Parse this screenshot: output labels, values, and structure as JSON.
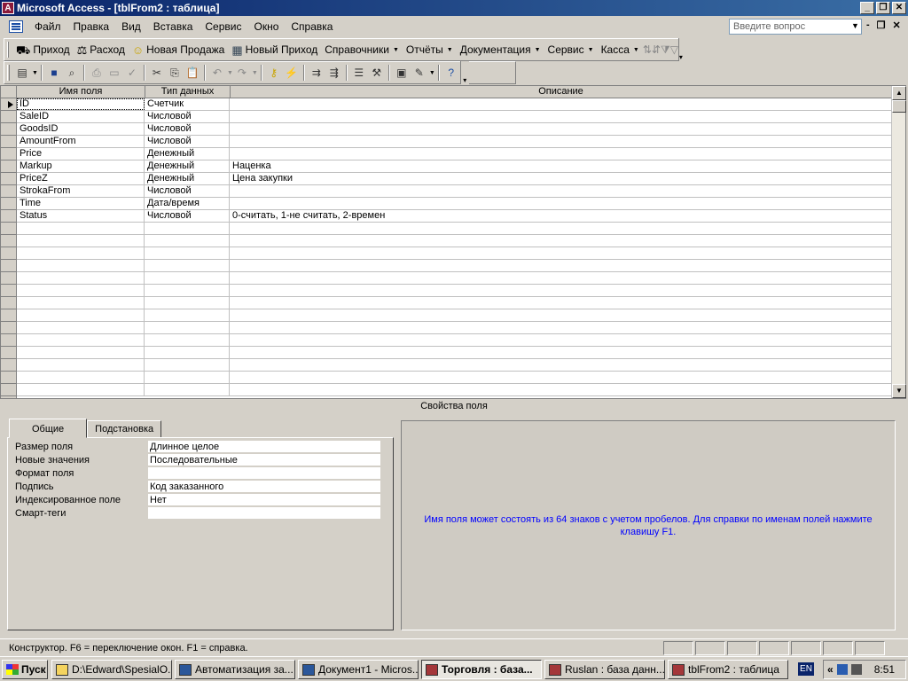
{
  "window": {
    "title": "Microsoft Access - [tblFrom2 : таблица]",
    "app_icon": "access-icon",
    "controls": [
      "_",
      "❐",
      "✕"
    ]
  },
  "menu": {
    "items": [
      "Файл",
      "Правка",
      "Вид",
      "Вставка",
      "Сервис",
      "Окно",
      "Справка"
    ],
    "ask_placeholder": "Введите вопрос",
    "doc_controls": [
      "-",
      "❐",
      "✕"
    ]
  },
  "custom_toolbar": {
    "buttons": [
      {
        "label": "Приход",
        "icon": "truck-icon",
        "has_menu": false
      },
      {
        "label": "Расход",
        "icon": "scales-icon",
        "has_menu": false
      },
      {
        "label": "Новая Продажа",
        "icon": "smiley-icon",
        "has_menu": false
      },
      {
        "label": "Новый Приход",
        "icon": "document-icon",
        "has_menu": false
      },
      {
        "label": "Справочники",
        "icon": "",
        "has_menu": true
      },
      {
        "label": "Отчёты",
        "icon": "",
        "has_menu": true
      },
      {
        "label": "Документация",
        "icon": "",
        "has_menu": true
      },
      {
        "label": "Сервис",
        "icon": "",
        "has_menu": true
      },
      {
        "label": "Касса",
        "icon": "",
        "has_menu": true
      }
    ]
  },
  "table_design": {
    "headers": {
      "name": "Имя поля",
      "type": "Тип данных",
      "desc": "Описание"
    },
    "fields": [
      {
        "name": "ID",
        "type": "Счетчик",
        "desc": ""
      },
      {
        "name": "SaleID",
        "type": "Числовой",
        "desc": ""
      },
      {
        "name": "GoodsID",
        "type": "Числовой",
        "desc": ""
      },
      {
        "name": "AmountFrom",
        "type": "Числовой",
        "desc": ""
      },
      {
        "name": "Price",
        "type": "Денежный",
        "desc": ""
      },
      {
        "name": "Markup",
        "type": "Денежный",
        "desc": "Наценка"
      },
      {
        "name": "PriceZ",
        "type": "Денежный",
        "desc": "Цена  закупки"
      },
      {
        "name": "StrokaFrom",
        "type": "Числовой",
        "desc": ""
      },
      {
        "name": "Time",
        "type": "Дата/время",
        "desc": ""
      },
      {
        "name": "Status",
        "type": "Числовой",
        "desc": "0-считать, 1-не считать, 2-времен"
      }
    ]
  },
  "field_properties": {
    "title": "Свойства поля",
    "tabs": [
      "Общие",
      "Подстановка"
    ],
    "active_tab": "Общие",
    "props": [
      {
        "label": "Размер поля",
        "value": "Длинное целое"
      },
      {
        "label": "Новые значения",
        "value": "Последовательные"
      },
      {
        "label": "Формат поля",
        "value": ""
      },
      {
        "label": "Подпись",
        "value": "Код заказанного"
      },
      {
        "label": "Индексированное поле",
        "value": "Нет"
      },
      {
        "label": "Смарт-теги",
        "value": ""
      }
    ],
    "help_text": "Имя поля может состоять из 64 знаков с учетом пробелов.  Для справки по именам полей нажмите клавишу F1."
  },
  "statusbar": {
    "text": "Конструктор.  F6 = переключение окон.  F1 = справка."
  },
  "taskbar": {
    "start_label": "Пуск",
    "tasks": [
      {
        "label": "D:\\Edward\\SpesialO...",
        "icon": "folder",
        "active": false
      },
      {
        "label": "Автоматизация за...",
        "icon": "word",
        "active": false
      },
      {
        "label": "Документ1 - Micros...",
        "icon": "word",
        "active": false
      },
      {
        "label": "Торговля : база...",
        "icon": "access",
        "active": true
      },
      {
        "label": "Ruslan : база данн...",
        "icon": "access",
        "active": false
      },
      {
        "label": "tblFrom2 : таблица",
        "icon": "access",
        "active": false
      }
    ],
    "lang": "EN",
    "tray_arrow": "«",
    "clock": "8:51"
  }
}
